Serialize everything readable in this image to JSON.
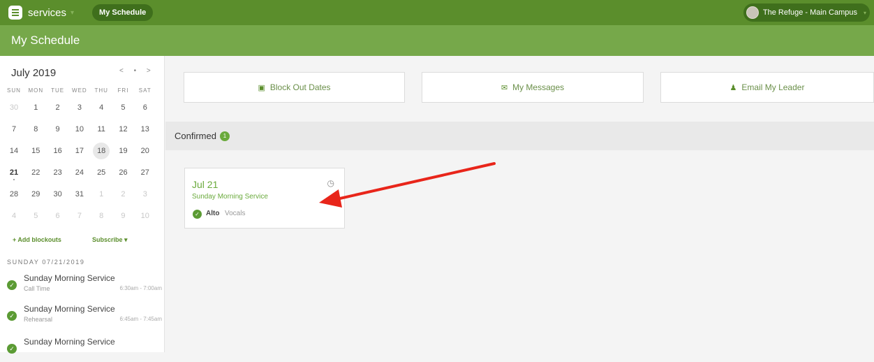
{
  "topbar": {
    "app_name": "services",
    "nav_active": "My Schedule",
    "org_name": "The Refuge - Main Campus"
  },
  "page": {
    "title": "My Schedule"
  },
  "calendar": {
    "month_label": "July 2019",
    "nav_glyphs": "< • >",
    "weekdays": [
      "SUN",
      "MON",
      "TUE",
      "WED",
      "THU",
      "FRI",
      "SAT"
    ],
    "weeks": [
      [
        "30",
        "1",
        "2",
        "3",
        "4",
        "5",
        "6"
      ],
      [
        "7",
        "8",
        "9",
        "10",
        "11",
        "12",
        "13"
      ],
      [
        "14",
        "15",
        "16",
        "17",
        "18",
        "19",
        "20"
      ],
      [
        "21",
        "22",
        "23",
        "24",
        "25",
        "26",
        "27"
      ],
      [
        "28",
        "29",
        "30",
        "31",
        "1",
        "2",
        "3"
      ],
      [
        "4",
        "5",
        "6",
        "7",
        "8",
        "9",
        "10"
      ]
    ],
    "today": "18",
    "event_day": "21"
  },
  "sidebar": {
    "add_blockouts": "+ Add blockouts",
    "subscribe": "Subscribe ▾",
    "date_heading": "SUNDAY 07/21/2019",
    "items": [
      {
        "name": "Sunday Morning Service",
        "kind": "Call Time",
        "time": "6:30am - 7:00am"
      },
      {
        "name": "Sunday Morning Service",
        "kind": "Rehearsal",
        "time": "6:45am - 7:45am"
      },
      {
        "name": "Sunday Morning Service",
        "kind": "",
        "time": ""
      }
    ]
  },
  "actions": {
    "block_out": "Block Out Dates",
    "messages": "My Messages",
    "email_leader": "Email My Leader"
  },
  "confirmed": {
    "label": "Confirmed",
    "count": "1"
  },
  "card": {
    "date": "Jul 21",
    "service": "Sunday Morning Service",
    "position": "Alto",
    "team": "Vocals"
  },
  "colors": {
    "topbar": "#5b8e2c",
    "header": "#76a84a",
    "accent_green": "#6aaa3c",
    "arrow": "#e8251a"
  }
}
